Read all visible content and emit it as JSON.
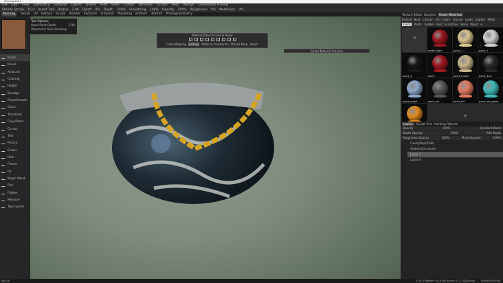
{
  "window": {
    "title": "3D-Coat 2021"
  },
  "menu": [
    "File",
    "Edit",
    "View",
    "Symmetry",
    "Textures",
    "Layers",
    "Freeze",
    "Hide",
    "Bake",
    "Curves",
    "Windows",
    "Scripts",
    "Help",
    "Always",
    "Connective Picking"
  ],
  "toolbar": {
    "steady_stroke": "Steady Stroke",
    "steady_val": "15.0",
    "invert_tool": "Invert Tool",
    "radius": "Radius",
    "radius_val": "2.90",
    "falloff": "Falloff",
    "falloff_val": "0%",
    "depth": "Depth",
    "depth_val": "100%",
    "smoothing": "Smoothing",
    "smoothing_val": "100%",
    "opacity": "Opacity",
    "opacity_val": "100%",
    "roughness": "Roughness",
    "roughness_val": "0%",
    "metalness": "Metalness",
    "metalness_val": "0%"
  },
  "rooms": [
    "Painting",
    "Tweak",
    "UV",
    "Retopo",
    "Sculpt",
    "Render",
    "Factures",
    "Simplest",
    "Modeling",
    "KitBash",
    "3DPrint",
    "Photogrammetry"
  ],
  "tool_options": {
    "title": "Tool Options",
    "voxel_depth": "Voxel Paint Depth",
    "voxel_depth_val": "2.00",
    "volumetric": "Volumetric Slice Painting"
  },
  "tools": [
    "Brush",
    "Pencil",
    "Airbrush",
    "Coloring",
    "Height",
    "Smudge",
    "PowerSmooth",
    "Clone",
    "Transform",
    "Copy/Paste",
    "Curves",
    "Text",
    "Picture",
    "Eraser",
    "Hide",
    "Freeze",
    "Fill",
    "Magic Wand",
    "Pick",
    "Flatten",
    "Measure",
    "Topo-symm"
  ],
  "control_panel": {
    "title": "Material/Stencil Control Panel",
    "cube_mapping": "Cube Mapping",
    "settings": "Settings",
    "material_transforms": "Material transforms",
    "stencil_keep": "Stencil Keep",
    "volume": "Volum"
  },
  "smart_material_preview": "Smart Material Preview",
  "right_tabs": [
    "Texture Editor",
    "Brushes",
    "Smart Materials"
  ],
  "categories": [
    "Default",
    "Bark",
    "Cartoon",
    "Dirt",
    "Fabric",
    "Ground",
    "Leaks",
    "Leather",
    "Metal",
    "Paints",
    "Plastic",
    "Rubber",
    "Rust",
    "Scratches",
    "Stone",
    "Wood",
    "+"
  ],
  "materials": [
    {
      "name": "",
      "color": ""
    },
    {
      "name": "metal_light",
      "color": "#9a1820"
    },
    {
      "name": "paint_1",
      "color": "#d8c48e"
    },
    {
      "name": "paint_2",
      "color": "#d0d0d0"
    },
    {
      "name": "paint_3",
      "color": "#1a1a1a"
    },
    {
      "name": "paint",
      "color": "#a01822"
    },
    {
      "name": "paint_cream",
      "color": "#c8b488"
    },
    {
      "name": "paint_dark",
      "color": "#2a2a2a"
    },
    {
      "name": "paint_metal",
      "color": "#8aa6c8"
    },
    {
      "name": "paint_old",
      "color": "#555555"
    },
    {
      "name": "paint_old",
      "color": "#e07a62"
    },
    {
      "name": "paint_old_green",
      "color": "#40b8b8"
    },
    {
      "name": "paint_orange",
      "color": "#e08a20"
    }
  ],
  "layer_tabs": [
    "Layers",
    "Sculpt Tree",
    "Painting Objects"
  ],
  "layer_props": [
    [
      "Opacity",
      "100%",
      "Standard Blend"
    ],
    [
      "Depth Opacity",
      "100%",
      "Add Depth"
    ],
    [
      "Roughness Opacity",
      "100%",
      "Metal Opacity",
      "100%"
    ]
  ],
  "layers": [
    "CavityMap(RGB)",
    "AmbientOcclusion",
    "Layer 1",
    "Layer 0"
  ],
  "status": {
    "left": "fps:26",
    "coords": "X:19.7589mm  Y:0.039234mm  Z:-4.79204mm",
    "view": "[PERSPECTIVE]"
  },
  "watermark": "THE GNOMON WORKSHOP",
  "colors": {
    "accent": "#444444",
    "swatch": "#8a5a3c",
    "pot": "#1e2a33",
    "chain": "#d4a520"
  }
}
